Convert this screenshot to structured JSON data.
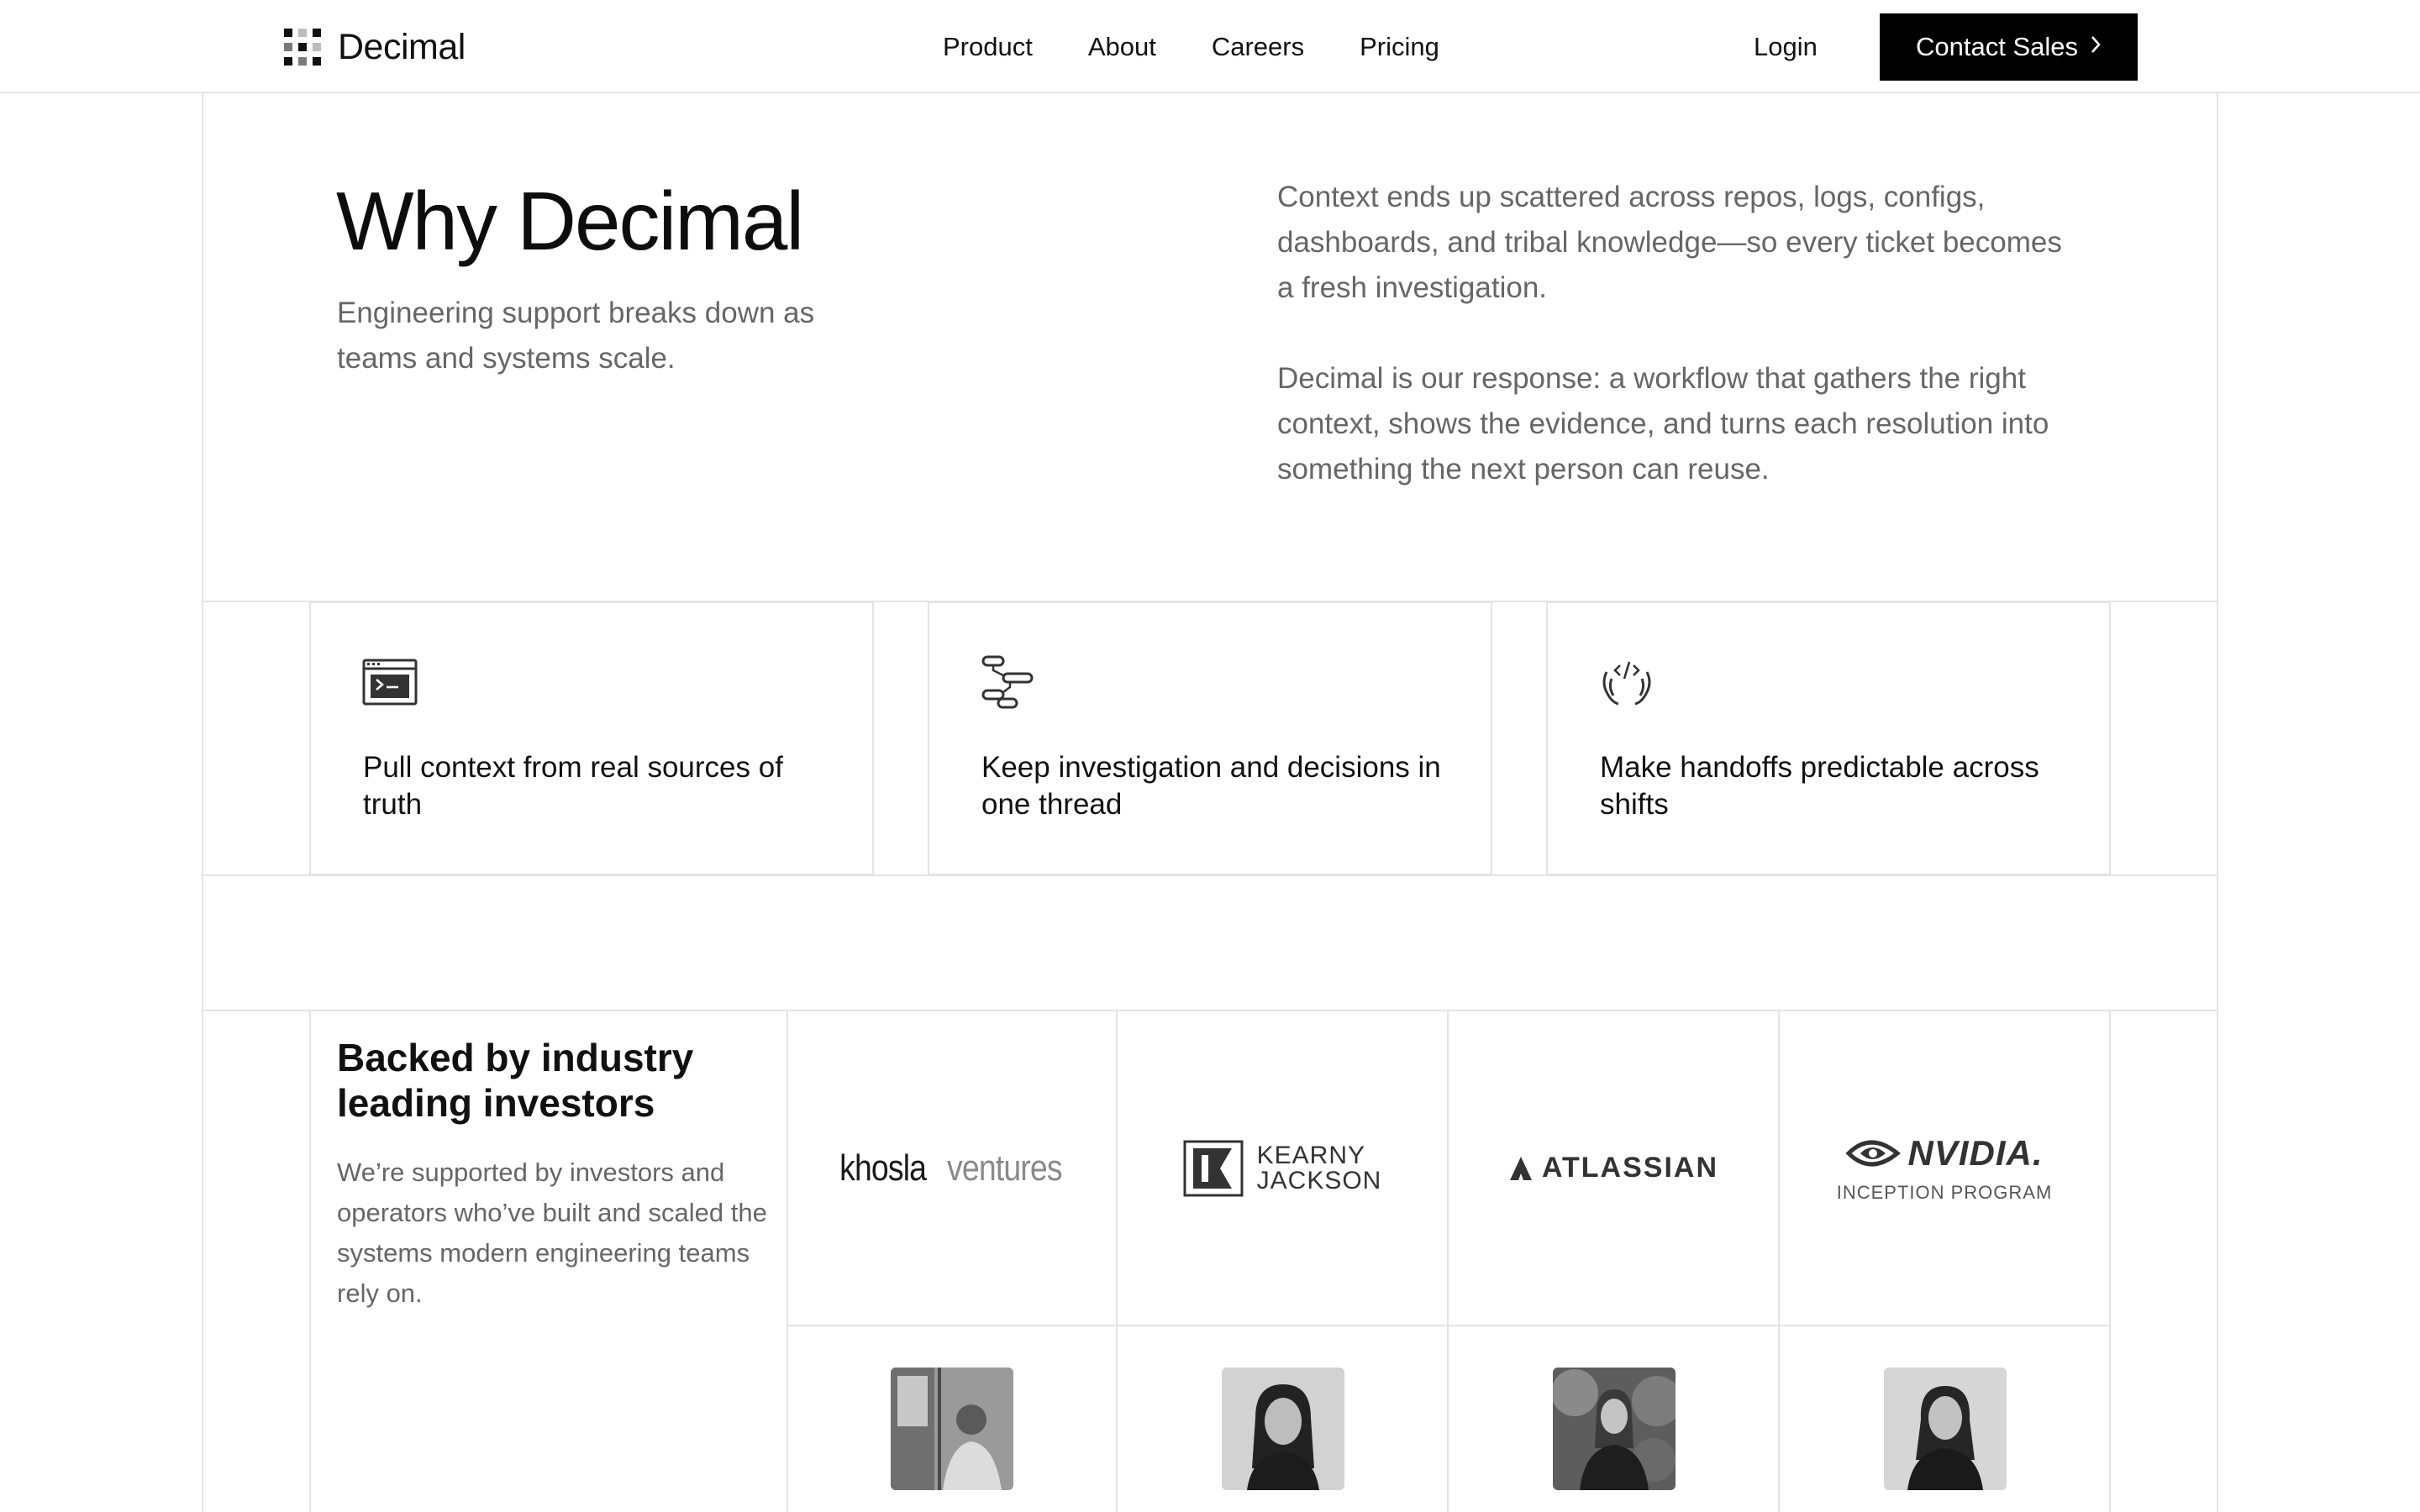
{
  "header": {
    "logo_text": "Decimal",
    "nav": [
      "Product",
      "About",
      "Careers",
      "Pricing"
    ],
    "login": "Login",
    "cta": "Contact Sales"
  },
  "hero": {
    "title": "Why Decimal",
    "subtitle": "Engineering support breaks down as teams and systems scale.",
    "paragraph_1": "Context ends up scattered across repos, logs, configs, dashboards, and tribal knowledge—so every ticket becomes a fresh investigation.",
    "paragraph_2": "Decimal is our response: a workflow that gathers the right context, shows the evidence, and turns each resolution into something the next person can reuse."
  },
  "features": [
    {
      "icon": "terminal-icon",
      "title": "Pull context from real sources of truth"
    },
    {
      "icon": "thread-icon",
      "title": "Keep investigation and decisions in one thread"
    },
    {
      "icon": "handoff-icon",
      "title": "Make handoffs predictable across shifts"
    }
  ],
  "investors": {
    "title": "Backed by industry leading investors",
    "description": "We’re supported by investors and operators who’ve built and scaled the systems modern engineering teams rely on.",
    "logos": {
      "khosla_1": "khosla",
      "khosla_2": "ventures",
      "kearny_1": "KEARNY",
      "kearny_2": "JACKSON",
      "atlassian": "ATLASSIAN",
      "nvidia": "NVIDIA.",
      "nvidia_sub": "INCEPTION PROGRAM"
    }
  }
}
